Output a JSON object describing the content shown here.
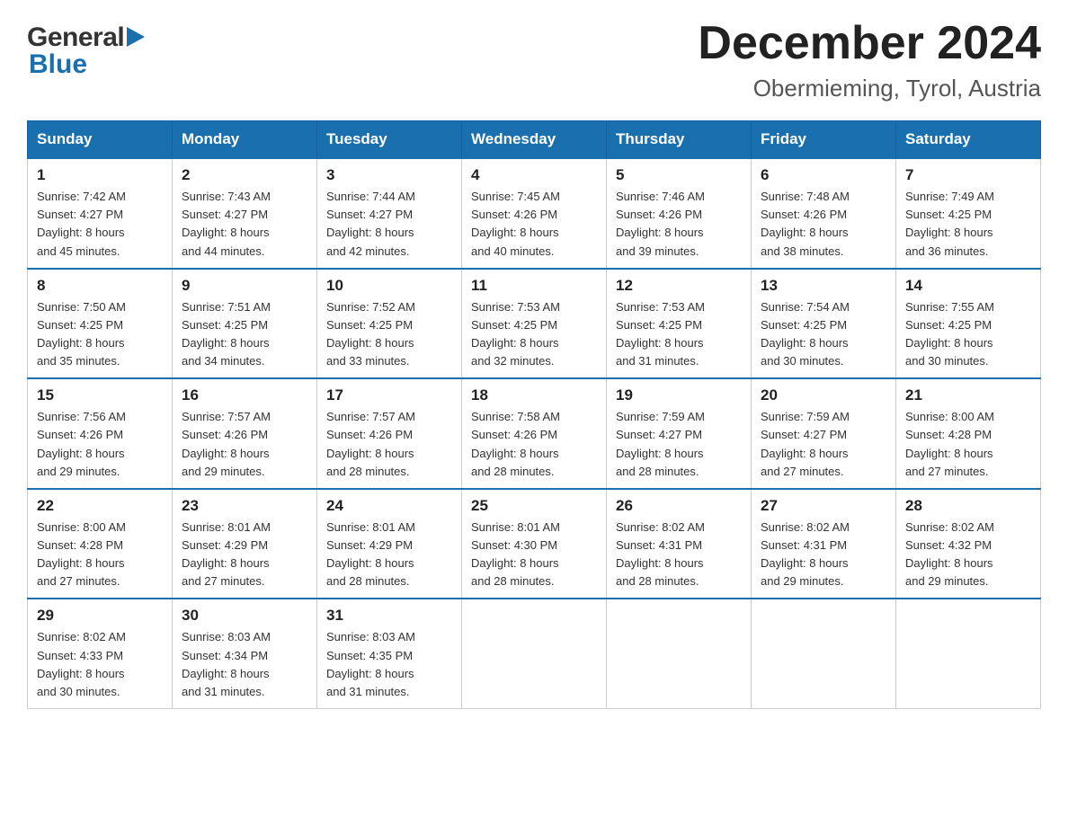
{
  "header": {
    "logo_general": "General",
    "logo_blue": "Blue",
    "main_title": "December 2024",
    "subtitle": "Obermieming, Tyrol, Austria"
  },
  "calendar": {
    "days_of_week": [
      "Sunday",
      "Monday",
      "Tuesday",
      "Wednesday",
      "Thursday",
      "Friday",
      "Saturday"
    ],
    "weeks": [
      [
        {
          "day": "1",
          "sunrise": "7:42 AM",
          "sunset": "4:27 PM",
          "daylight": "8 hours and 45 minutes."
        },
        {
          "day": "2",
          "sunrise": "7:43 AM",
          "sunset": "4:27 PM",
          "daylight": "8 hours and 44 minutes."
        },
        {
          "day": "3",
          "sunrise": "7:44 AM",
          "sunset": "4:27 PM",
          "daylight": "8 hours and 42 minutes."
        },
        {
          "day": "4",
          "sunrise": "7:45 AM",
          "sunset": "4:26 PM",
          "daylight": "8 hours and 40 minutes."
        },
        {
          "day": "5",
          "sunrise": "7:46 AM",
          "sunset": "4:26 PM",
          "daylight": "8 hours and 39 minutes."
        },
        {
          "day": "6",
          "sunrise": "7:48 AM",
          "sunset": "4:26 PM",
          "daylight": "8 hours and 38 minutes."
        },
        {
          "day": "7",
          "sunrise": "7:49 AM",
          "sunset": "4:25 PM",
          "daylight": "8 hours and 36 minutes."
        }
      ],
      [
        {
          "day": "8",
          "sunrise": "7:50 AM",
          "sunset": "4:25 PM",
          "daylight": "8 hours and 35 minutes."
        },
        {
          "day": "9",
          "sunrise": "7:51 AM",
          "sunset": "4:25 PM",
          "daylight": "8 hours and 34 minutes."
        },
        {
          "day": "10",
          "sunrise": "7:52 AM",
          "sunset": "4:25 PM",
          "daylight": "8 hours and 33 minutes."
        },
        {
          "day": "11",
          "sunrise": "7:53 AM",
          "sunset": "4:25 PM",
          "daylight": "8 hours and 32 minutes."
        },
        {
          "day": "12",
          "sunrise": "7:53 AM",
          "sunset": "4:25 PM",
          "daylight": "8 hours and 31 minutes."
        },
        {
          "day": "13",
          "sunrise": "7:54 AM",
          "sunset": "4:25 PM",
          "daylight": "8 hours and 30 minutes."
        },
        {
          "day": "14",
          "sunrise": "7:55 AM",
          "sunset": "4:25 PM",
          "daylight": "8 hours and 30 minutes."
        }
      ],
      [
        {
          "day": "15",
          "sunrise": "7:56 AM",
          "sunset": "4:26 PM",
          "daylight": "8 hours and 29 minutes."
        },
        {
          "day": "16",
          "sunrise": "7:57 AM",
          "sunset": "4:26 PM",
          "daylight": "8 hours and 29 minutes."
        },
        {
          "day": "17",
          "sunrise": "7:57 AM",
          "sunset": "4:26 PM",
          "daylight": "8 hours and 28 minutes."
        },
        {
          "day": "18",
          "sunrise": "7:58 AM",
          "sunset": "4:26 PM",
          "daylight": "8 hours and 28 minutes."
        },
        {
          "day": "19",
          "sunrise": "7:59 AM",
          "sunset": "4:27 PM",
          "daylight": "8 hours and 28 minutes."
        },
        {
          "day": "20",
          "sunrise": "7:59 AM",
          "sunset": "4:27 PM",
          "daylight": "8 hours and 27 minutes."
        },
        {
          "day": "21",
          "sunrise": "8:00 AM",
          "sunset": "4:28 PM",
          "daylight": "8 hours and 27 minutes."
        }
      ],
      [
        {
          "day": "22",
          "sunrise": "8:00 AM",
          "sunset": "4:28 PM",
          "daylight": "8 hours and 27 minutes."
        },
        {
          "day": "23",
          "sunrise": "8:01 AM",
          "sunset": "4:29 PM",
          "daylight": "8 hours and 27 minutes."
        },
        {
          "day": "24",
          "sunrise": "8:01 AM",
          "sunset": "4:29 PM",
          "daylight": "8 hours and 28 minutes."
        },
        {
          "day": "25",
          "sunrise": "8:01 AM",
          "sunset": "4:30 PM",
          "daylight": "8 hours and 28 minutes."
        },
        {
          "day": "26",
          "sunrise": "8:02 AM",
          "sunset": "4:31 PM",
          "daylight": "8 hours and 28 minutes."
        },
        {
          "day": "27",
          "sunrise": "8:02 AM",
          "sunset": "4:31 PM",
          "daylight": "8 hours and 29 minutes."
        },
        {
          "day": "28",
          "sunrise": "8:02 AM",
          "sunset": "4:32 PM",
          "daylight": "8 hours and 29 minutes."
        }
      ],
      [
        {
          "day": "29",
          "sunrise": "8:02 AM",
          "sunset": "4:33 PM",
          "daylight": "8 hours and 30 minutes."
        },
        {
          "day": "30",
          "sunrise": "8:03 AM",
          "sunset": "4:34 PM",
          "daylight": "8 hours and 31 minutes."
        },
        {
          "day": "31",
          "sunrise": "8:03 AM",
          "sunset": "4:35 PM",
          "daylight": "8 hours and 31 minutes."
        },
        null,
        null,
        null,
        null
      ]
    ],
    "labels": {
      "sunrise": "Sunrise:",
      "sunset": "Sunset:",
      "daylight": "Daylight:"
    }
  }
}
